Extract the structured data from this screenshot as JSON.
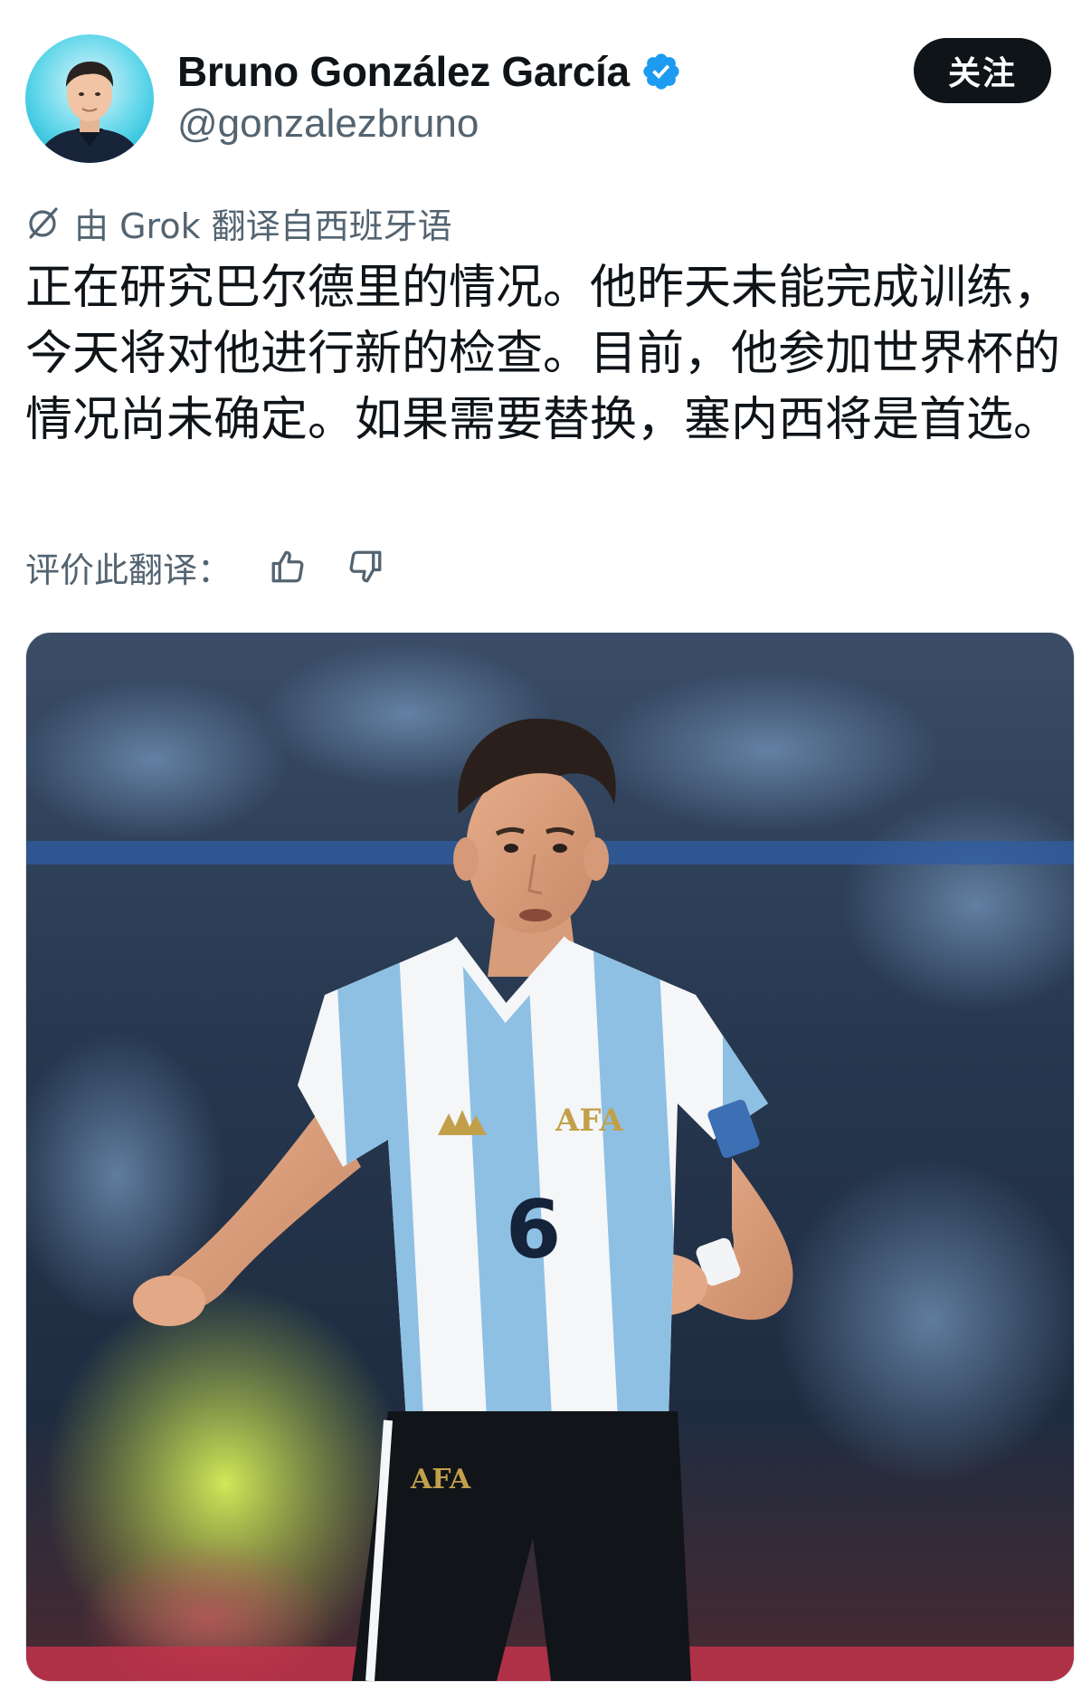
{
  "author": {
    "display_name": "Bruno González García",
    "handle": "@gonzalezbruno",
    "verified_color": "#1d9bf0"
  },
  "follow_button": {
    "label": "关注"
  },
  "translation": {
    "attribution": "由 Grok 翻译自西班牙语",
    "icon": "grok-icon"
  },
  "tweet": {
    "text": "正在研究巴尔德里的情况。他昨天未能完成训练，今天将对他进行新的检查。目前，他参加世界杯的情况尚未确定。如果需要替换，塞内西将是首选。"
  },
  "rate": {
    "label": "评价此翻译：",
    "thumbs_up_icon": "thumbs-up-icon",
    "thumbs_down_icon": "thumbs-down-icon"
  },
  "media": {
    "jersey_number": "6",
    "crest_text": "AFA",
    "shorts_text": "AFA",
    "colors": {
      "stripe": "#8ec0e4",
      "shorts": "#111418",
      "crowd": "#2b3f5a"
    }
  }
}
